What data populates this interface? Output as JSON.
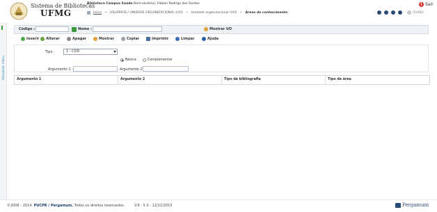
{
  "header": {
    "brand_line1": "Sistema de Bibliotecas",
    "brand_line2": "UFMG",
    "library": "Biblioteca Campus Saúde",
    "welcome": "Bem-vindo(a), Fabian Rodrigo dos Santos",
    "breadcrumb": {
      "home": "Início",
      "items": [
        "USUÁRIOS / UNIDADE ORGANIZACIONAL (UO)",
        "Unidade organizacional (UO)",
        "Áreas de conhecimento"
      ]
    },
    "logout": "Sair",
    "language": "(EUSB)",
    "icons": [
      "settings-icon",
      "help-icon",
      "info-icon",
      "mail-icon"
    ]
  },
  "side_tab": {
    "label": "Visualizar menu"
  },
  "search": {
    "codigo_label": "Código :",
    "nome_label": "Nome :",
    "mostrar_uo": "Mostrar UO"
  },
  "toolbar": {
    "inserir": "Inserir",
    "alterar": "Alterar",
    "apagar": "Apagar",
    "mostrar": "Mostrar",
    "copiar": "Copiar",
    "imprimir": "Imprimir",
    "limpar": "Limpar",
    "ajuda": "Ajuda"
  },
  "form": {
    "tipo_label": "Tipo",
    "tipo_value": "1 - CDD",
    "radio_basica": "Básica",
    "radio_complementar": "Complementar",
    "argumento1_label": "Argumento 1 :",
    "argumento2_label": "Argumento 2 :"
  },
  "table": {
    "columns": [
      "Argumento 1",
      "Argumento 2",
      "Tipo de bibliografia",
      "Tipo de área"
    ]
  },
  "footer": {
    "copyright_prefix": "©2008 - 2014.",
    "company": "PUCPR / Pergamum.",
    "rights": "Todos os direitos reservados.",
    "version": "V.9 - 5.0 - 12/11/2015",
    "brand": "Pergamum"
  },
  "colors": {
    "accent": "#2b4a73",
    "green": "#3a9a3a",
    "border": "#d6dbe3"
  }
}
